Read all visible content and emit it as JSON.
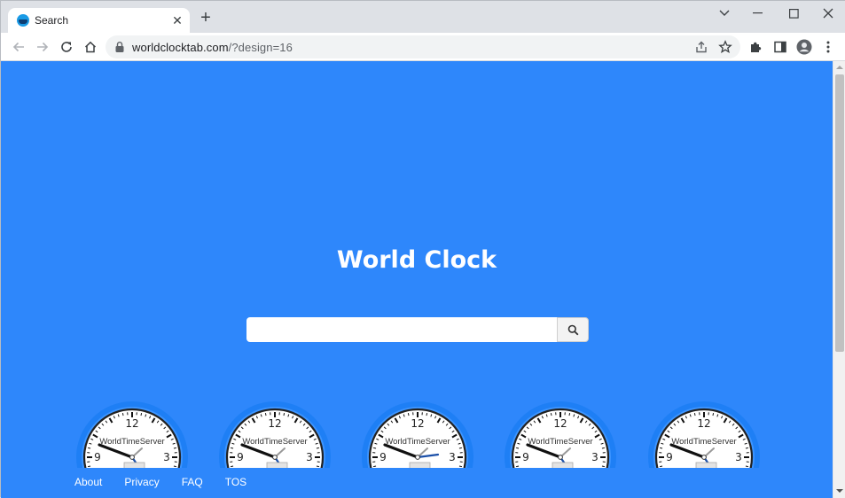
{
  "browser": {
    "tab": {
      "title": "Search"
    },
    "address": {
      "domain": "worldclocktab.com",
      "path": "/?design=16"
    }
  },
  "page": {
    "title": "World Clock",
    "search": {
      "value": "",
      "placeholder": ""
    },
    "clock_brand": "WorldTimeServer",
    "clock_numbers": {
      "twelve": "12",
      "three": "3",
      "nine": "9"
    },
    "footer": {
      "links": [
        {
          "label": "About"
        },
        {
          "label": "Privacy"
        },
        {
          "label": "FAQ"
        },
        {
          "label": "TOS"
        }
      ]
    }
  },
  "colors": {
    "page_background": "#2e87fb",
    "clock_rim": "#1e7ff5",
    "second_hand": "#1a4fa8"
  }
}
